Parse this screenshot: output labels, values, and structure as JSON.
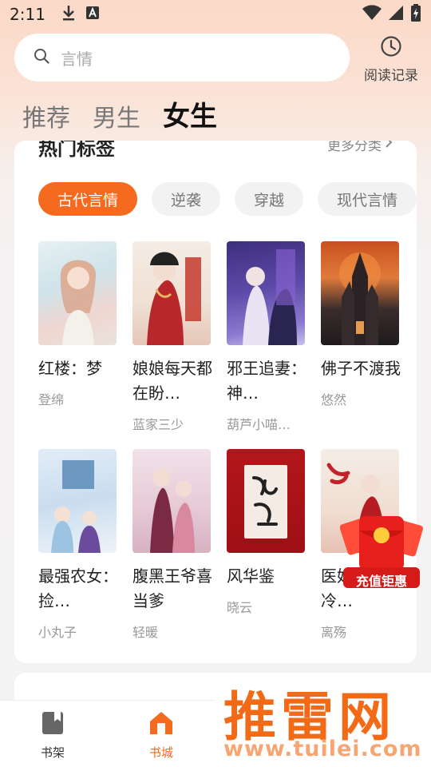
{
  "status_bar": {
    "time": "2:11"
  },
  "search": {
    "placeholder": "言情"
  },
  "history": {
    "label": "阅读记录"
  },
  "tabs": [
    {
      "label": "推荐",
      "active": false
    },
    {
      "label": "男生",
      "active": false
    },
    {
      "label": "女生",
      "active": true
    }
  ],
  "section": {
    "title": "热门标签",
    "more": "更多分类"
  },
  "chips": [
    {
      "label": "古代言情",
      "active": true
    },
    {
      "label": "逆袭",
      "active": false
    },
    {
      "label": "穿越",
      "active": false
    },
    {
      "label": "现代言情",
      "active": false
    }
  ],
  "books": [
    {
      "title": "红楼：梦",
      "author": "登绵"
    },
    {
      "title": "娘娘每天都在盼…",
      "author": "蓝家三少"
    },
    {
      "title": "邪王追妻：神…",
      "author": "葫芦小喵…"
    },
    {
      "title": "佛子不渡我",
      "author": "悠然"
    },
    {
      "title": "最强农女：捡…",
      "author": "小丸子"
    },
    {
      "title": "腹黑王爷喜当爹",
      "author": "轻暖"
    },
    {
      "title": "风华鉴",
      "author": "晓云"
    },
    {
      "title": "医妃天：冷…",
      "author": "离殇"
    }
  ],
  "promo": {
    "label": "充值钜惠"
  },
  "bottom_nav": [
    {
      "label": "书架",
      "active": false
    },
    {
      "label": "书城",
      "active": true
    }
  ],
  "watermark": {
    "brand": "推雷网",
    "url": "www.tuilei.com"
  },
  "colors": {
    "accent": "#f56a1e"
  }
}
